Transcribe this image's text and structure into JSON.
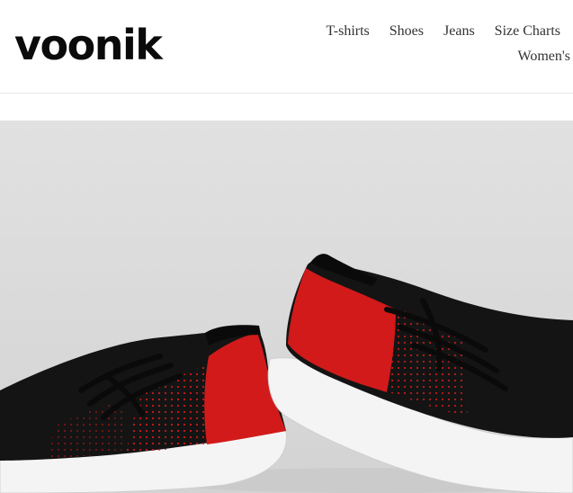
{
  "brand": {
    "logo_text": "voonik"
  },
  "nav": {
    "row1": [
      "T-shirts",
      "Shoes",
      "Jeans",
      "Size Charts"
    ],
    "row2": [
      "Women's"
    ]
  },
  "hero": {
    "image_subject": "red-and-black-knit-sneakers",
    "colors": {
      "background": "#dcdcdc",
      "shoe_black": "#141414",
      "shoe_red": "#d21a1a",
      "sole": "#f4f4f4"
    }
  }
}
